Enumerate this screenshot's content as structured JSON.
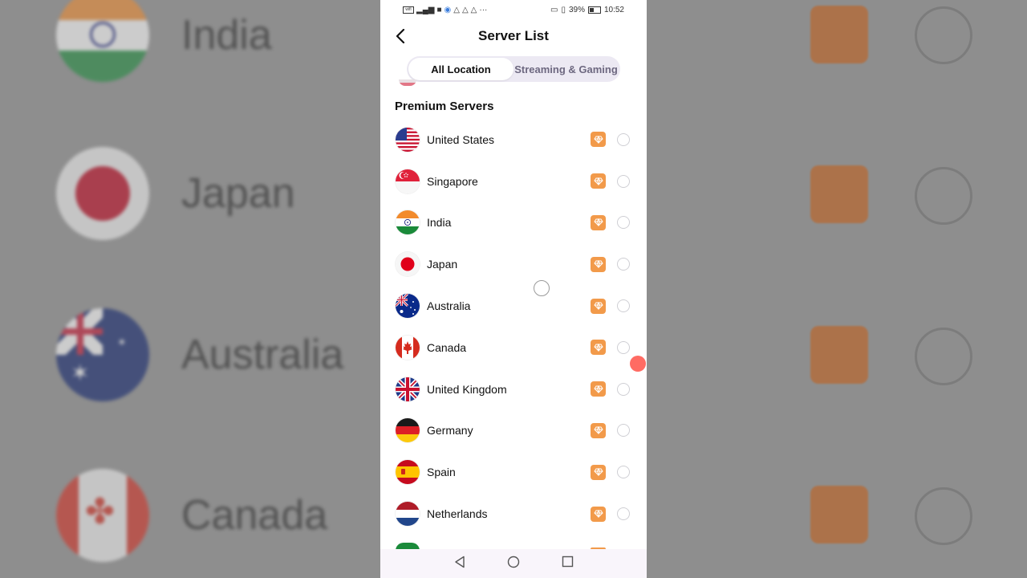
{
  "status_bar": {
    "left_icons": [
      "wifi-icon",
      "signal-icon",
      "camera-icon",
      "record-icon",
      "warning-icon",
      "warning-icon",
      "warning-icon"
    ],
    "more": "···",
    "battery": "39%",
    "time": "10:52"
  },
  "header": {
    "title": "Server List"
  },
  "tabs": [
    {
      "label": "All Location",
      "active": true
    },
    {
      "label": "Streaming & Gaming",
      "active": false
    }
  ],
  "section_title": "Premium Servers",
  "servers": [
    {
      "name": "United States",
      "flag": "us"
    },
    {
      "name": "Singapore",
      "flag": "sg"
    },
    {
      "name": "India",
      "flag": "in"
    },
    {
      "name": "Japan",
      "flag": "jp"
    },
    {
      "name": "Australia",
      "flag": "au"
    },
    {
      "name": "Canada",
      "flag": "ca"
    },
    {
      "name": "United Kingdom",
      "flag": "gb"
    },
    {
      "name": "Germany",
      "flag": "de"
    },
    {
      "name": "Spain",
      "flag": "es"
    },
    {
      "name": "Netherlands",
      "flag": "nl"
    }
  ],
  "background_labels": [
    "India",
    "Japan",
    "Australia",
    "Canada"
  ],
  "colors": {
    "premium": "#f29a4a",
    "radio_border": "#cfcfd4"
  }
}
